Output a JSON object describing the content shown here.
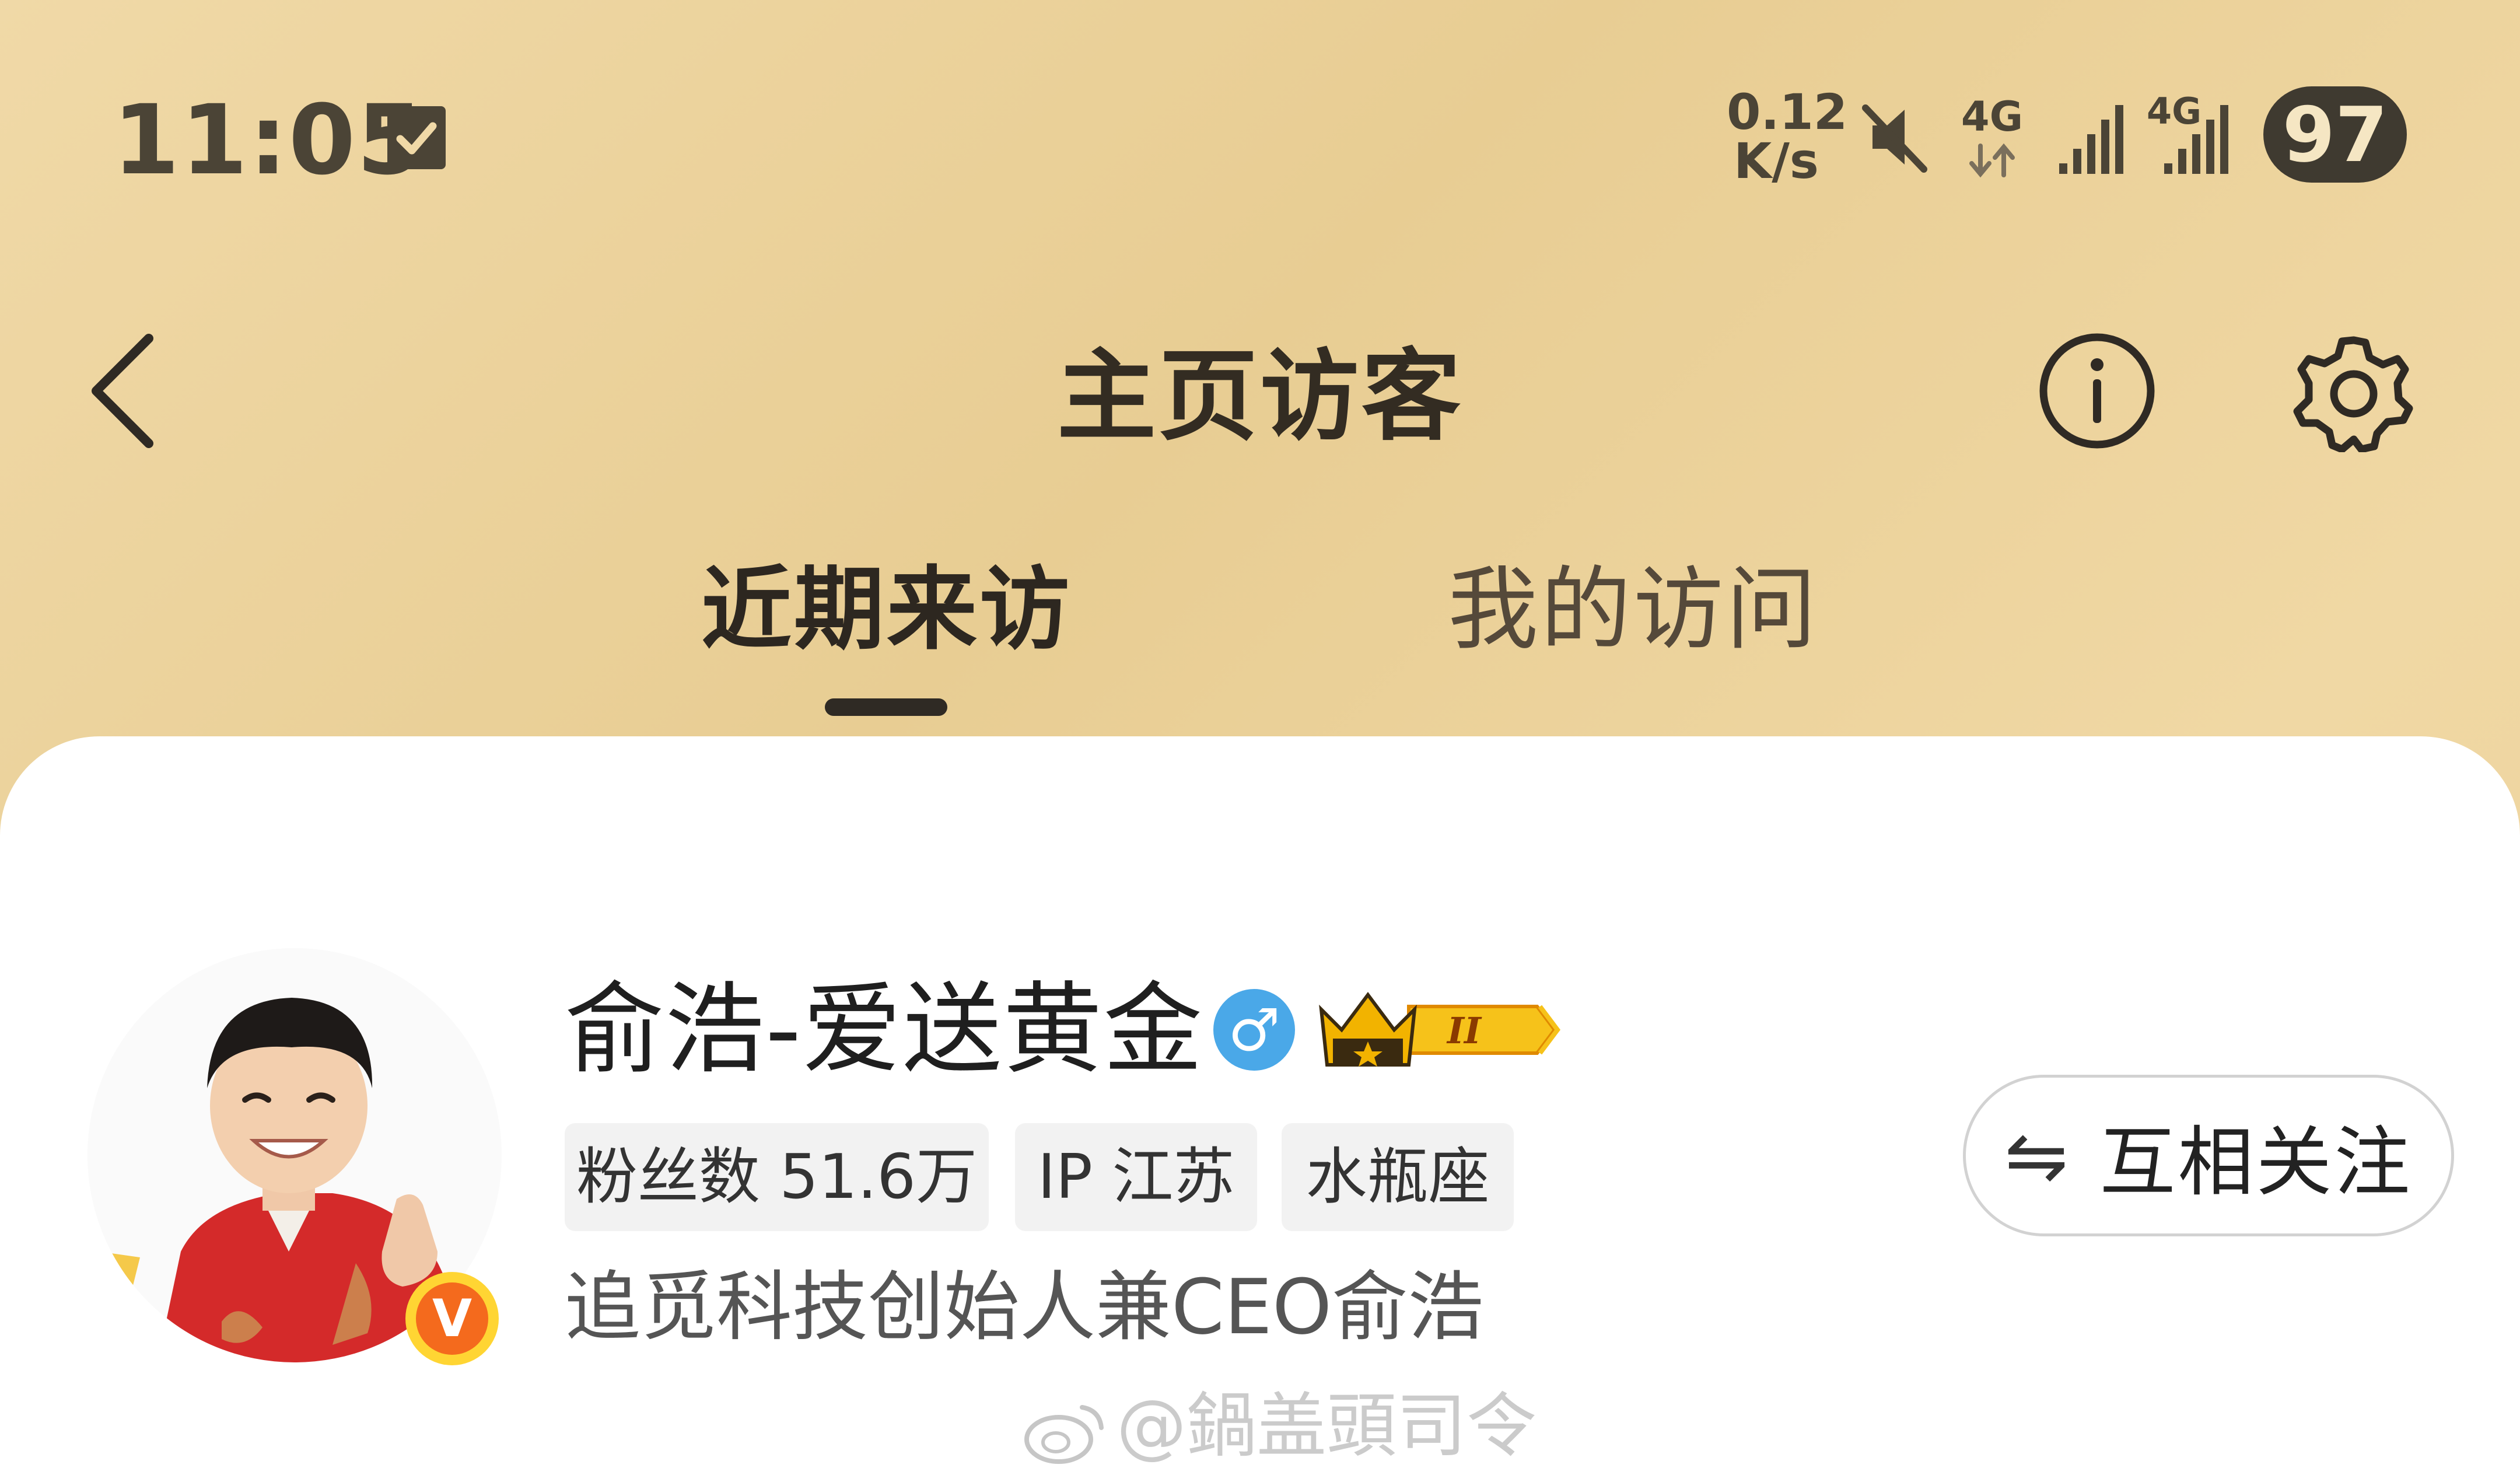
{
  "status_bar": {
    "time": "11:05",
    "net_speed_value": "0.12",
    "net_speed_unit": "K/s",
    "network_type_1": "4G",
    "network_type_2": "4G",
    "battery": "97",
    "icons": [
      "checkbox-icon",
      "mute-icon",
      "network-arrows-icon",
      "signal-icon",
      "signal-icon"
    ]
  },
  "header": {
    "title": "主页访客",
    "icons": [
      "back-icon",
      "info-icon",
      "settings-icon"
    ]
  },
  "tabs": [
    {
      "label": "近期来访",
      "active": true
    },
    {
      "label": "我的访问",
      "active": false
    }
  ],
  "visitor": {
    "name": "俞浩-爱送黄金",
    "gender_symbol": "♂",
    "level_badge": "II",
    "tags": {
      "fans": "粉丝数 51.6万",
      "ip": "IP 江苏",
      "zodiac": "水瓶座"
    },
    "bio": "追觅科技创始人兼CEO俞浩",
    "verified_badge": "V",
    "follow_button": {
      "icon": "⇋",
      "label": "互相关注"
    }
  },
  "watermark": "@鍋盖頭司令",
  "colors": {
    "header_bg": "#ecd29c",
    "card_bg": "#ffffff",
    "gender_blue": "#4aa8e8",
    "verified_orange": "#f08a1a",
    "crown_gold": "#f2b300",
    "tag_bg": "#f2f2f2"
  }
}
